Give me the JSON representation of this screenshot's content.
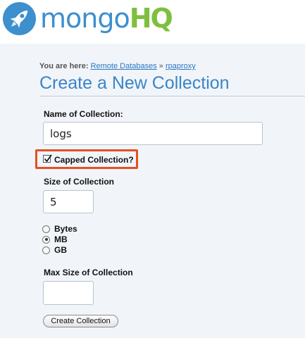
{
  "brand": {
    "logo_part1": "mongo",
    "logo_part2": "HQ",
    "logo_icon": "rocket-icon",
    "blue": "#3d8fce",
    "green": "#7fbf3f"
  },
  "breadcrumb": {
    "prefix": "You are here:",
    "link1": "Remote Databases",
    "separator": "»",
    "link2": "rpaproxy"
  },
  "page_title": "Create a New Collection",
  "form": {
    "name_label": "Name of Collection:",
    "name_value": "logs",
    "capped_label": "Capped Collection?",
    "capped_checked": true,
    "size_label": "Size of Collection",
    "size_value": "5",
    "units": [
      {
        "label": "Bytes",
        "checked": false
      },
      {
        "label": "MB",
        "checked": true
      },
      {
        "label": "GB",
        "checked": false
      }
    ],
    "max_size_label": "Max Size of Collection",
    "max_size_value": "",
    "submit_label": "Create Collection"
  },
  "colors": {
    "highlight": "#e55025",
    "title": "#3b84c7",
    "link": "#2a75c2",
    "background": "#f1f5f9"
  }
}
